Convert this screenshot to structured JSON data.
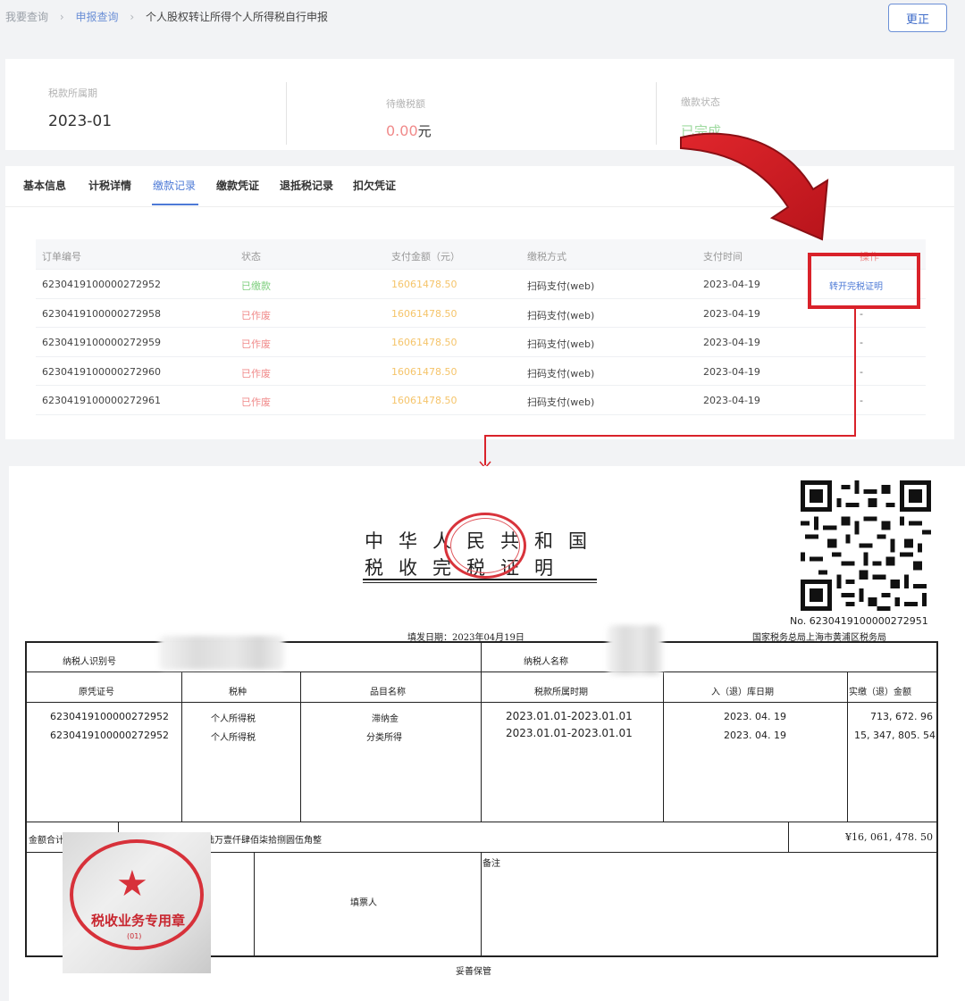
{
  "breadcrumb": {
    "items": [
      "我要查询",
      "申报查询",
      "个人股权转让所得个人所得税自行申报"
    ]
  },
  "header": {
    "correct_button": "更正"
  },
  "summary": {
    "period_label": "税款所属期",
    "period_value": "2023-01",
    "amount_label": "待缴税额",
    "amount_value": "0.00",
    "amount_unit": "元",
    "status_label": "缴款状态",
    "status_value": "已完成"
  },
  "tabs": [
    "基本信息",
    "计税详情",
    "缴款记录",
    "缴款凭证",
    "退抵税记录",
    "扣欠凭证"
  ],
  "active_tab": "缴款记录",
  "payments": {
    "headers": [
      "订单编号",
      "状态",
      "支付金额（元）",
      "缴税方式",
      "支付时间",
      "操作"
    ],
    "rows": [
      {
        "order": "6230419100000272952",
        "status": "已缴款",
        "amount": "16061478.50",
        "method": "扫码支付(web)",
        "time": "2023-04-19",
        "op": "转开完税证明"
      },
      {
        "order": "6230419100000272958",
        "status": "已作废",
        "amount": "16061478.50",
        "method": "扫码支付(web)",
        "time": "2023-04-19",
        "op": "-"
      },
      {
        "order": "6230419100000272959",
        "status": "已作废",
        "amount": "16061478.50",
        "method": "扫码支付(web)",
        "time": "2023-04-19",
        "op": "-"
      },
      {
        "order": "6230419100000272960",
        "status": "已作废",
        "amount": "16061478.50",
        "method": "扫码支付(web)",
        "time": "2023-04-19",
        "op": "-"
      },
      {
        "order": "6230419100000272961",
        "status": "已作废",
        "amount": "16061478.50",
        "method": "扫码支付(web)",
        "time": "2023-04-19",
        "op": "-"
      }
    ]
  },
  "certificate": {
    "title_line1": "中华人民共和国",
    "title_line2": "税收完税证明",
    "number": "No. 6230419100000272951",
    "bureau": "国家税务总局上海市黄浦区税务局",
    "fill_date": "填发日期：2023年04月19日",
    "taxpayer_id_label": "纳税人识别号",
    "taxpayer_name_label": "纳税人名称",
    "columns": [
      "原凭证号",
      "税种",
      "品目名称",
      "税款所属时期",
      "入（退）库日期",
      "实缴（退）金额"
    ],
    "lines": [
      {
        "voucher": "6230419100000272952",
        "tax": "个人所得税",
        "item": "滞纳金",
        "period": "2023.01.01-2023.01.01",
        "date": "2023. 04. 19",
        "amount": "713, 672. 96"
      },
      {
        "voucher": "6230419100000272952",
        "tax": "个人所得税",
        "item": "分类所得",
        "period": "2023.01.01-2023.01.01",
        "date": "2023. 04. 19",
        "amount": "15, 347, 805. 54"
      }
    ],
    "total_label": "金额合计",
    "total_words": "（大写）壹仟陆佰零陆万壹仟肆佰柒拾捌圆伍角整",
    "total_amount": "¥16, 061, 478. 50",
    "remark_label": "备注",
    "filler_label": "填票人",
    "footer": "妥善保管",
    "stamp_text": "税收业务专用章",
    "stamp_sub": "(01)",
    "seal_ring_text": "国家税务总局上海市黄浦区税务局"
  },
  "colors": {
    "accent": "#4d7ad6",
    "paid": "#7fcf7f",
    "void": "#f08a8a",
    "amount": "#f5c46a",
    "annotation_red": "#d9222a"
  }
}
